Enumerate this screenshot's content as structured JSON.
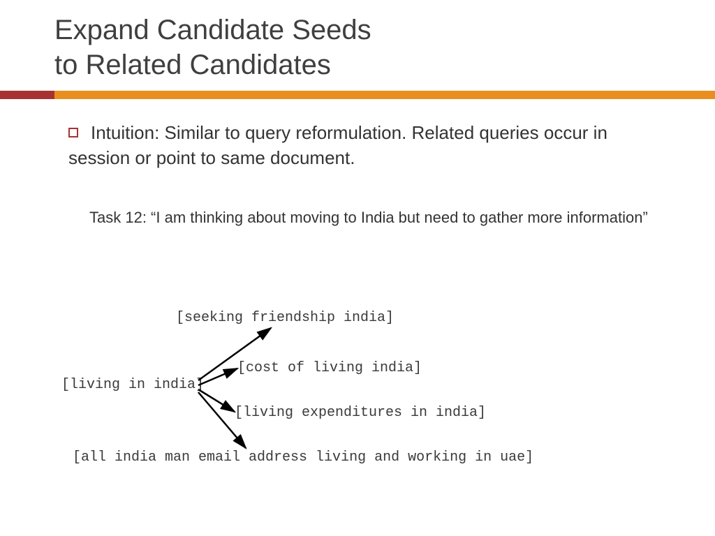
{
  "title_line1": "Expand Candidate Seeds",
  "title_line2": "to Related Candidates",
  "bullet": "Intuition: Similar to query reformulation.  Related queries occur in session or point to same document.",
  "task": "Task 12: “I am thinking about moving to India but need to gather more information”",
  "diagram": {
    "seed": "[living in india]",
    "expansions": [
      "[seeking friendship india]",
      "[cost of living india]",
      "[living expenditures in india]",
      "[all india man email address living and working in uae]"
    ]
  }
}
